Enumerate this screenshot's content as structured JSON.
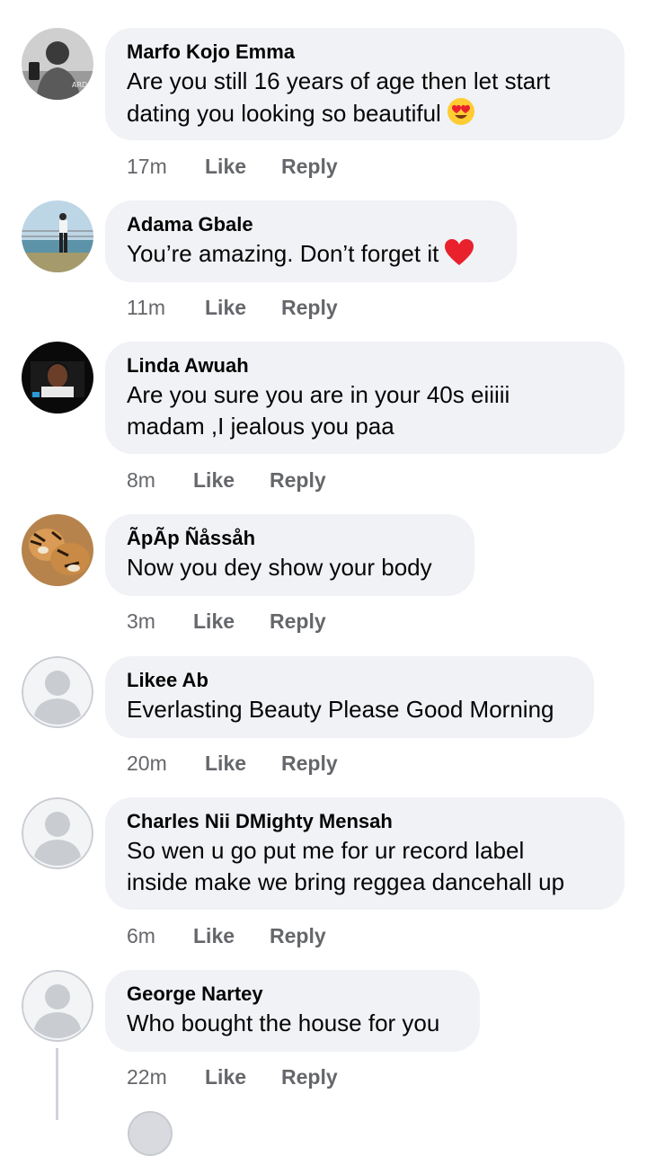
{
  "comments": [
    {
      "author": "Marfo Kojo Emma",
      "lines": [
        "Are you still 16 years of age then let start",
        "dating you looking so beautiful"
      ],
      "emoji": "heart-eyes",
      "time": "17m",
      "like": "Like",
      "reply": "Reply"
    },
    {
      "author": "Adama Gbale",
      "lines": [
        "You’re amazing. Don’t forget it"
      ],
      "emoji": "red-heart",
      "time": "11m",
      "like": "Like",
      "reply": "Reply"
    },
    {
      "author": "Linda Awuah",
      "lines": [
        "Are you sure you are in your 40s eiiiii",
        "madam ,I jealous you paa"
      ],
      "time": "8m",
      "like": "Like",
      "reply": "Reply"
    },
    {
      "author": "ÃpÃp Ñåssåh",
      "lines": [
        "Now you dey show your body"
      ],
      "time": "3m",
      "like": "Like",
      "reply": "Reply"
    },
    {
      "author": "Likee Ab",
      "lines": [
        "Everlasting Beauty Please Good Morning"
      ],
      "time": "20m",
      "like": "Like",
      "reply": "Reply"
    },
    {
      "author": "Charles Nii DMighty Mensah",
      "lines": [
        "So wen u go put me for ur record label",
        "inside make we bring reggea dancehall up"
      ],
      "time": "6m",
      "like": "Like",
      "reply": "Reply"
    },
    {
      "author": "George Nartey",
      "lines": [
        "Who bought the house for you"
      ],
      "time": "22m",
      "like": "Like",
      "reply": "Reply"
    }
  ],
  "colors": {
    "bubble": "#f0f2f5",
    "meta": "#65676b",
    "text": "#050505",
    "heart": "#e8212d"
  }
}
